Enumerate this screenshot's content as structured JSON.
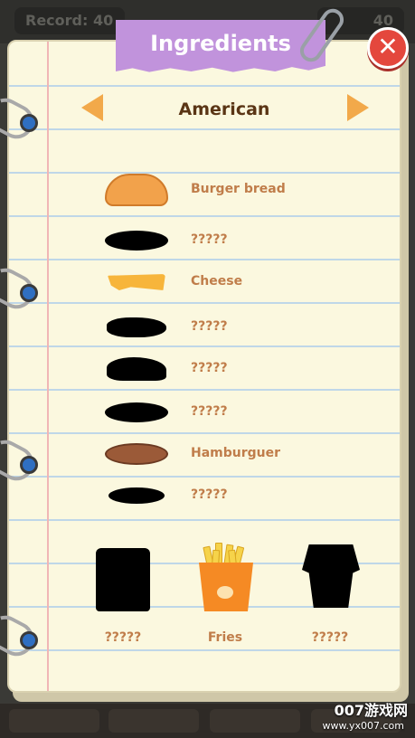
{
  "topbar": {
    "record_label": "Record: 40",
    "right_value": "40"
  },
  "title": "Ingredients",
  "close_icon": "close-icon",
  "category": "American",
  "ingredients": [
    {
      "label": "Burger bread",
      "icon": "burger-bun-icon",
      "unlocked": true
    },
    {
      "label": "?????",
      "icon": "locked-silhouette-icon",
      "unlocked": false
    },
    {
      "label": "Cheese",
      "icon": "cheese-slice-icon",
      "unlocked": true
    },
    {
      "label": "?????",
      "icon": "locked-silhouette-icon",
      "unlocked": false
    },
    {
      "label": "?????",
      "icon": "locked-silhouette-icon",
      "unlocked": false
    },
    {
      "label": "?????",
      "icon": "locked-silhouette-icon",
      "unlocked": false
    },
    {
      "label": "Hamburguer",
      "icon": "patty-icon",
      "unlocked": true
    },
    {
      "label": "?????",
      "icon": "locked-silhouette-icon",
      "unlocked": false
    }
  ],
  "sides": [
    {
      "label": "?????",
      "icon": "locked-silhouette-icon",
      "unlocked": false
    },
    {
      "label": "Fries",
      "icon": "fries-icon",
      "unlocked": true
    },
    {
      "label": "?????",
      "icon": "locked-silhouette-icon",
      "unlocked": false
    }
  ],
  "watermark": {
    "text": "007游戏网",
    "url": "www.yx007.com"
  },
  "colors": {
    "paper": "#fbf8df",
    "label": "#c07d4a",
    "title_tag": "#c193dc",
    "close": "#e4473d",
    "arrow": "#f2a94a"
  }
}
